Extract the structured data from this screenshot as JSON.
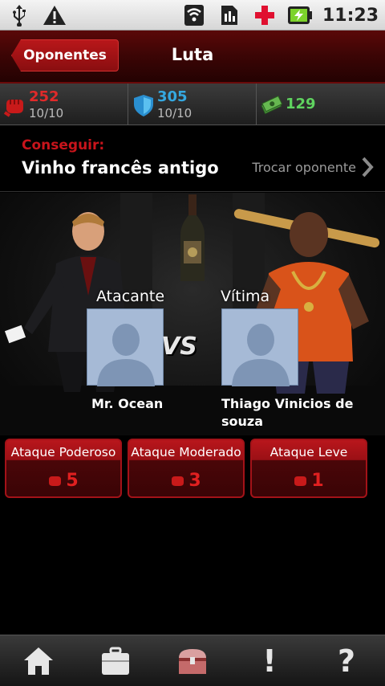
{
  "status_bar": {
    "time": "11:23",
    "icons": [
      "usb-icon",
      "warning-icon",
      "wifi-icon",
      "sim-icon",
      "red-cross-icon",
      "battery-charging-icon"
    ]
  },
  "header": {
    "back_label": "Oponentes",
    "title": "Luta"
  },
  "stats": {
    "attack": {
      "icon": "fist-icon",
      "value": "252",
      "sub": "10/10",
      "color": "#e02a2a"
    },
    "defense": {
      "icon": "shield-icon",
      "value": "305",
      "sub": "10/10",
      "color": "#35a8e0"
    },
    "money": {
      "icon": "cash-icon",
      "value": "129",
      "color": "#5fd35f"
    }
  },
  "objective": {
    "label": "Conseguir:",
    "item": "Vinho francês antigo",
    "swap_label": "Trocar oponente"
  },
  "fight": {
    "attacker_role": "Atacante",
    "victim_role": "Vítima",
    "vs_label": "VS",
    "attacker_name": "Mr. Ocean",
    "victim_name": "Thiago Vinicios de souza"
  },
  "attacks": [
    {
      "label": "Ataque Poderoso",
      "cost": "5"
    },
    {
      "label": "Ataque Moderado",
      "cost": "3"
    },
    {
      "label": "Ataque Leve",
      "cost": "1"
    }
  ],
  "bottom_nav": [
    {
      "icon": "home-icon"
    },
    {
      "icon": "briefcase-icon"
    },
    {
      "icon": "treasure-chest-icon"
    },
    {
      "icon": "exclamation-icon",
      "glyph": "!"
    },
    {
      "icon": "help-icon",
      "glyph": "?"
    }
  ],
  "colors": {
    "accent_red": "#c8141b",
    "header_red": "#5a0808",
    "text_gray": "#9a9a9a"
  }
}
